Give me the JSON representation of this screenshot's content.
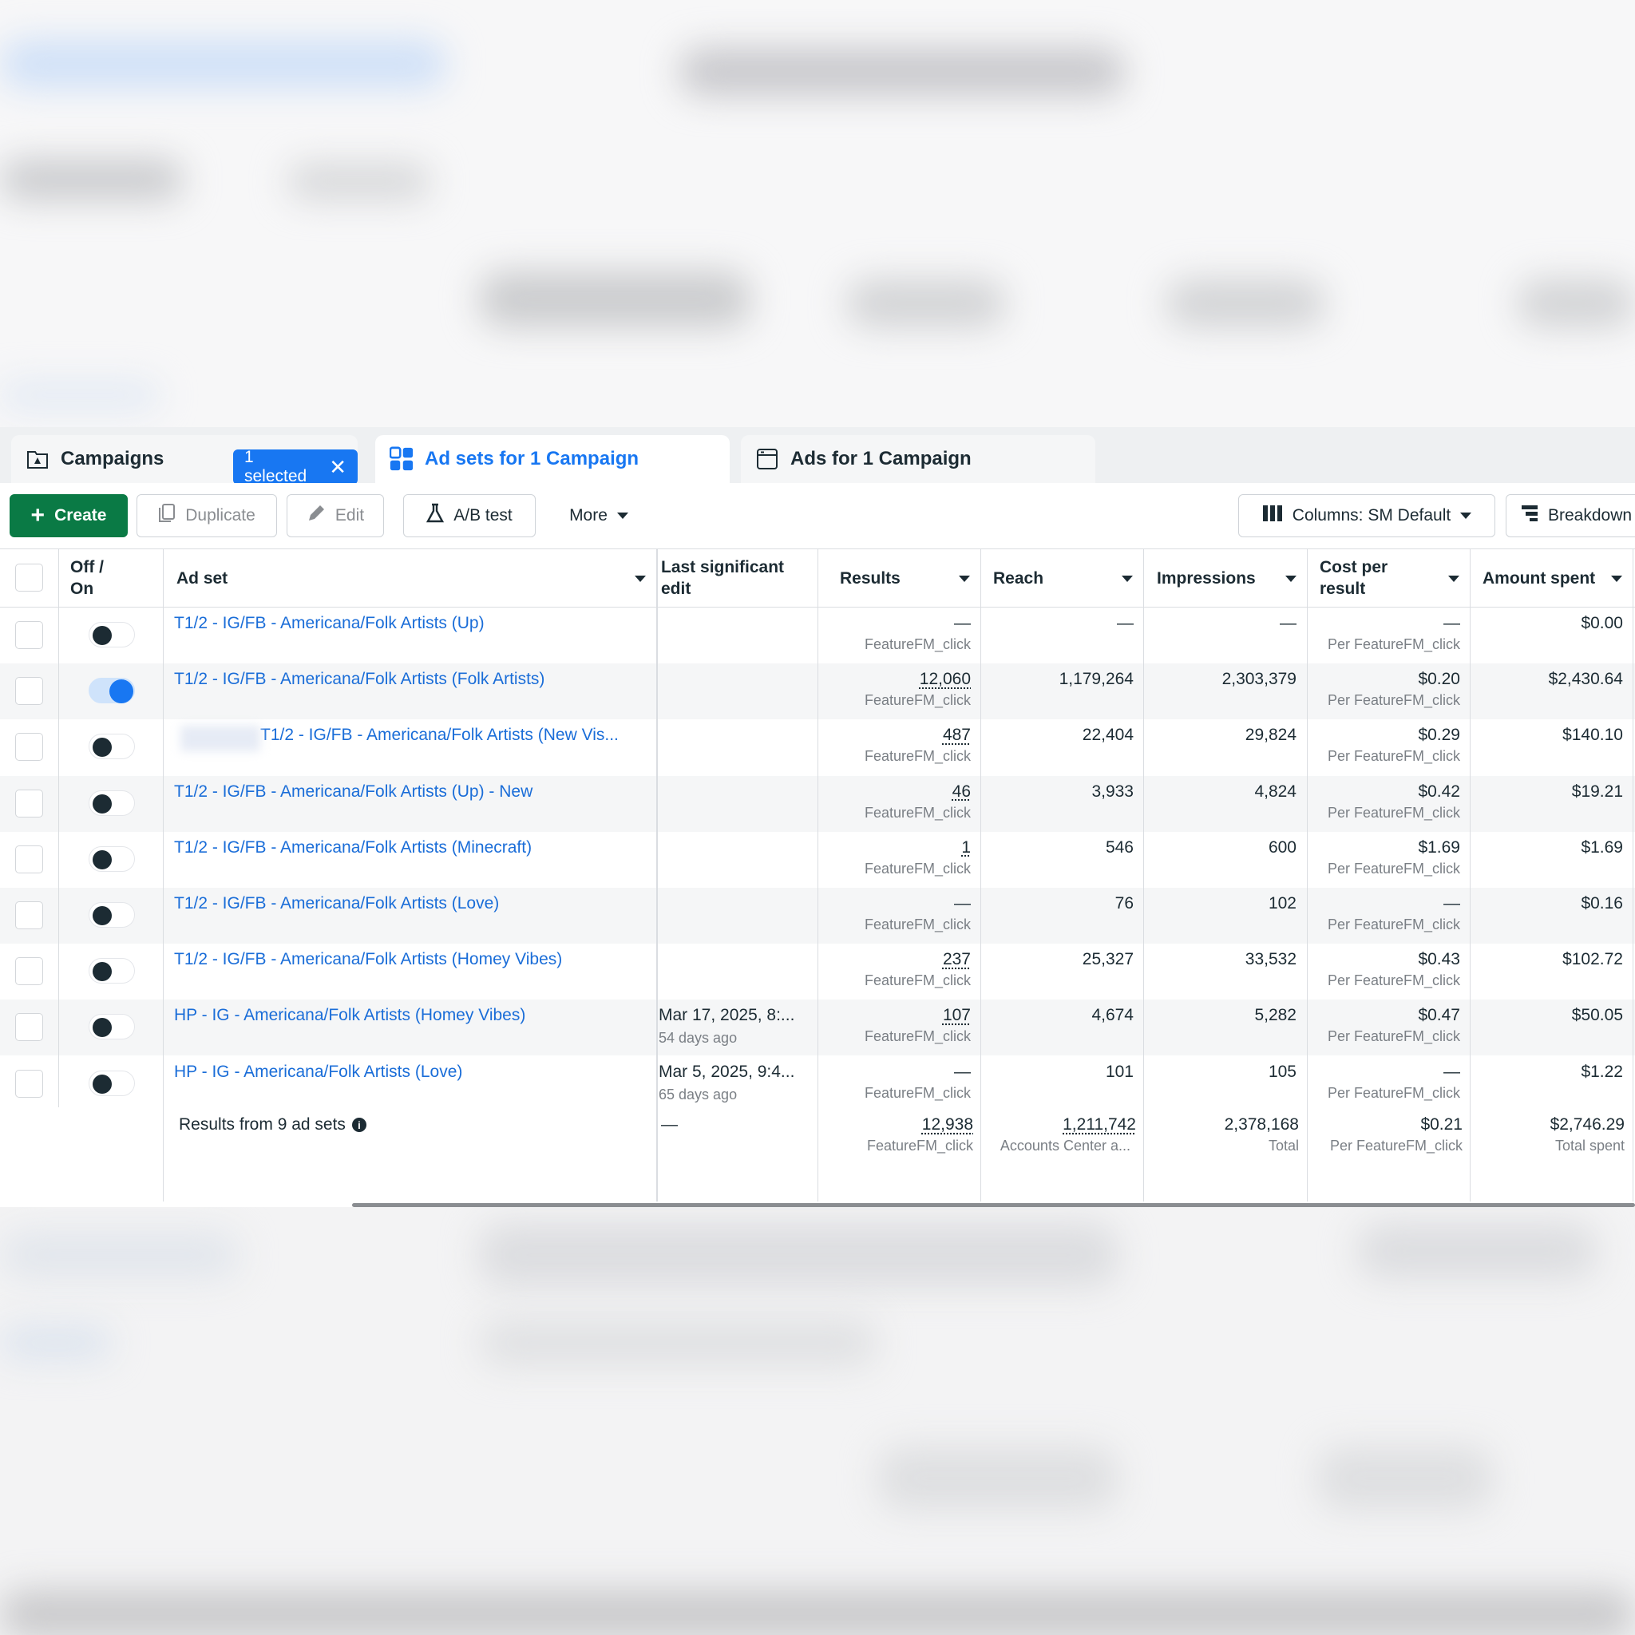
{
  "tabs": {
    "campaigns": "Campaigns",
    "selected_badge": "1 selected",
    "adsets": "Ad sets for 1 Campaign",
    "ads": "Ads for 1 Campaign"
  },
  "toolbar": {
    "create": "Create",
    "duplicate": "Duplicate",
    "edit": "Edit",
    "ab_test": "A/B test",
    "more": "More",
    "columns": "Columns: SM Default",
    "breakdown": "Breakdown"
  },
  "headers": {
    "off_on_1": "Off /",
    "off_on_2": "On",
    "ad_set": "Ad set",
    "last_edit_1": "Last significant",
    "last_edit_2": "edit",
    "results": "Results",
    "reach": "Reach",
    "impressions": "Impressions",
    "cost_1": "Cost per",
    "cost_2": "result",
    "amount": "Amount spent"
  },
  "rows": [
    {
      "name": "T1/2 - IG/FB - Americana/Folk Artists (Up)",
      "on": false,
      "edit_date": "",
      "edit_ago": "",
      "results": "—",
      "results_sub": "FeatureFM_click",
      "reach": "—",
      "impressions": "—",
      "cost": "—",
      "cost_sub": "Per FeatureFM_click",
      "amount": "$0.00"
    },
    {
      "name": "T1/2 - IG/FB - Americana/Folk Artists (Folk Artists)",
      "on": true,
      "edit_date": "",
      "edit_ago": "",
      "results": "12,060",
      "results_sub": "FeatureFM_click",
      "reach": "1,179,264",
      "impressions": "2,303,379",
      "cost": "$0.20",
      "cost_sub": "Per FeatureFM_click",
      "amount": "$2,430.64"
    },
    {
      "name": "T1/2 - IG/FB - Americana/Folk Artists (New Vis...",
      "on": false,
      "edit_date": "",
      "edit_ago": "",
      "results": "487",
      "results_sub": "FeatureFM_click",
      "reach": "22,404",
      "impressions": "29,824",
      "cost": "$0.29",
      "cost_sub": "Per FeatureFM_click",
      "amount": "$140.10"
    },
    {
      "name": "T1/2 - IG/FB - Americana/Folk Artists (Up) - New",
      "on": false,
      "edit_date": "",
      "edit_ago": "",
      "results": "46",
      "results_sub": "FeatureFM_click",
      "reach": "3,933",
      "impressions": "4,824",
      "cost": "$0.42",
      "cost_sub": "Per FeatureFM_click",
      "amount": "$19.21"
    },
    {
      "name": "T1/2 - IG/FB - Americana/Folk Artists (Minecraft)",
      "on": false,
      "edit_date": "",
      "edit_ago": "",
      "results": "1",
      "results_sub": "FeatureFM_click",
      "reach": "546",
      "impressions": "600",
      "cost": "$1.69",
      "cost_sub": "Per FeatureFM_click",
      "amount": "$1.69"
    },
    {
      "name": "T1/2 - IG/FB - Americana/Folk Artists (Love)",
      "on": false,
      "edit_date": "",
      "edit_ago": "",
      "results": "—",
      "results_sub": "FeatureFM_click",
      "reach": "76",
      "impressions": "102",
      "cost": "—",
      "cost_sub": "Per FeatureFM_click",
      "amount": "$0.16"
    },
    {
      "name": "T1/2 - IG/FB - Americana/Folk Artists (Homey Vibes)",
      "on": false,
      "edit_date": "",
      "edit_ago": "",
      "results": "237",
      "results_sub": "FeatureFM_click",
      "reach": "25,327",
      "impressions": "33,532",
      "cost": "$0.43",
      "cost_sub": "Per FeatureFM_click",
      "amount": "$102.72"
    },
    {
      "name": "HP - IG - Americana/Folk Artists (Homey Vibes)",
      "on": false,
      "edit_date": "Mar 17, 2025, 8:...",
      "edit_ago": "54 days ago",
      "results": "107",
      "results_sub": "FeatureFM_click",
      "reach": "4,674",
      "impressions": "5,282",
      "cost": "$0.47",
      "cost_sub": "Per FeatureFM_click",
      "amount": "$50.05"
    },
    {
      "name": "HP - IG - Americana/Folk Artists (Love)",
      "on": false,
      "edit_date": "Mar 5, 2025, 9:4...",
      "edit_ago": "65 days ago",
      "results": "—",
      "results_sub": "FeatureFM_click",
      "reach": "101",
      "impressions": "105",
      "cost": "—",
      "cost_sub": "Per FeatureFM_click",
      "amount": "$1.22"
    }
  ],
  "totals": {
    "label": "Results from 9 ad sets",
    "last_edit": "—",
    "results": "12,938",
    "results_sub": "FeatureFM_click",
    "reach": "1,211,742",
    "reach_sub": "Accounts Center a...",
    "impressions": "2,378,168",
    "impressions_sub": "Total",
    "cost": "$0.21",
    "cost_sub": "Per FeatureFM_click",
    "amount": "$2,746.29",
    "amount_sub": "Total spent"
  },
  "colors": {
    "accent": "#1877f2",
    "create_green": "#0a7a45",
    "link_blue": "#1a6dd8"
  }
}
